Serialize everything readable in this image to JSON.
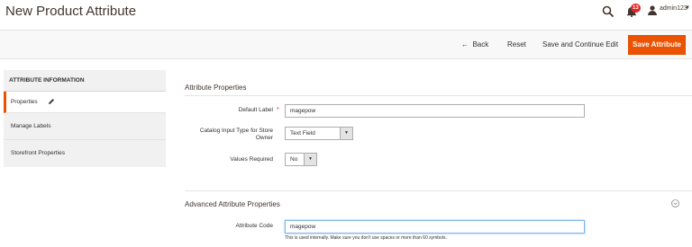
{
  "header": {
    "title": "New Product Attribute",
    "notification_count": "13",
    "admin_user": "admin123",
    "icons": [
      "search-icon",
      "bell-icon",
      "user-icon",
      "caret-down-icon"
    ]
  },
  "actions": {
    "back": "Back",
    "reset": "Reset",
    "save_continue": "Save and Continue Edit",
    "save_attribute": "Save Attribute"
  },
  "sidebar": {
    "heading": "ATTRIBUTE INFORMATION",
    "items": [
      {
        "label": "Properties",
        "active": true
      },
      {
        "label": "Manage Labels",
        "active": false
      },
      {
        "label": "Storefront Properties",
        "active": false
      }
    ]
  },
  "attribute_properties": {
    "title": "Attribute Properties",
    "default_label": {
      "label": "Default Label",
      "value": "magepow",
      "required": true
    },
    "input_type": {
      "label": "Catalog Input Type for Store Owner",
      "value": "Text Field"
    },
    "values_required": {
      "label": "Values Required",
      "value": "No"
    }
  },
  "advanced": {
    "title": "Advanced Attribute Properties",
    "attribute_code": {
      "label": "Attribute Code",
      "value": "magepow"
    },
    "note": "This is used internally. Make sure you don't use spaces or more than 60 symbols."
  },
  "colors": {
    "accent": "#eb5202",
    "badge": "#e22626",
    "focus": "#7eb6e6"
  }
}
